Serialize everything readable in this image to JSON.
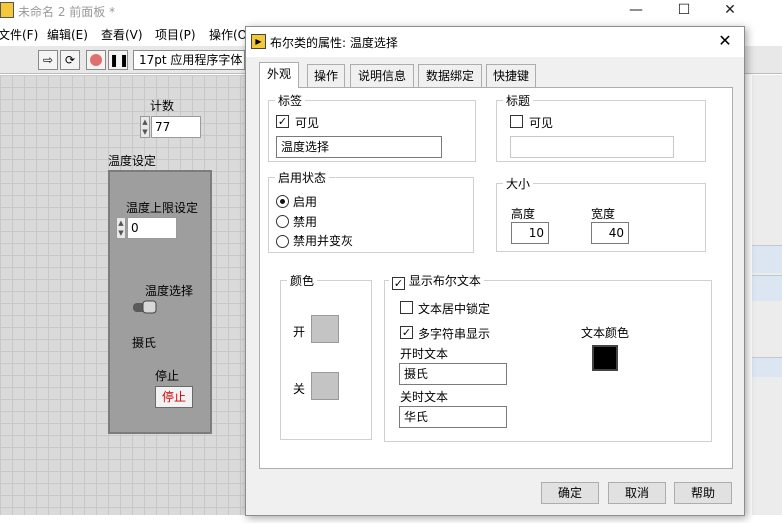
{
  "background_window": {
    "title": "未命名 2 前面板 *",
    "window_controls": {
      "minimize": "—",
      "maximize": "☐",
      "close": "✕"
    },
    "menu": [
      "文件(F)",
      "编辑(E)",
      "查看(V)",
      "项目(P)",
      "操作(O"
    ],
    "toolbar": {
      "font_select": "17pt 应用程序字体"
    },
    "front_panel": {
      "count_label": "计数",
      "count_value": "77",
      "temp_setting_label": "温度设定",
      "upper_limit_label": "温度上限设定",
      "upper_limit_value": "0",
      "temp_select_label": "温度选择",
      "switch_text": "摄氏",
      "stop_label": "停止",
      "stop_button": "停止"
    }
  },
  "dialog": {
    "title": "布尔类的属性: 温度选择",
    "close": "✕",
    "tabs": [
      "外观",
      "操作",
      "说明信息",
      "数据绑定",
      "快捷键"
    ],
    "active_tab": "外观",
    "label_group": {
      "title": "标签",
      "visible_label": "可见",
      "visible_checked": true,
      "value": "温度选择"
    },
    "caption_group": {
      "title": "标题",
      "visible_label": "可见",
      "visible_checked": false,
      "value": ""
    },
    "enable_group": {
      "title": "启用状态",
      "options": [
        "启用",
        "禁用",
        "禁用并变灰"
      ],
      "selected": "启用"
    },
    "size_group": {
      "title": "大小",
      "height_label": "高度",
      "height_value": "10",
      "width_label": "宽度",
      "width_value": "40"
    },
    "color_group": {
      "title": "颜色",
      "on_label": "开",
      "off_label": "关",
      "on_color": "#c4c4c4",
      "off_color": "#c4c4c4"
    },
    "bool_text_group": {
      "show_label": "显示布尔文本",
      "show_checked": true,
      "center_lock_label": "文本居中锁定",
      "center_lock_checked": false,
      "multi_string_label": "多字符串显示",
      "multi_string_checked": true,
      "text_color_label": "文本颜色",
      "text_color": "#000000",
      "on_text_label": "开时文本",
      "on_text_value": "摄氏",
      "off_text_label": "关时文本",
      "off_text_value": "华氏"
    },
    "buttons": {
      "ok": "确定",
      "cancel": "取消",
      "help": "帮助"
    }
  }
}
